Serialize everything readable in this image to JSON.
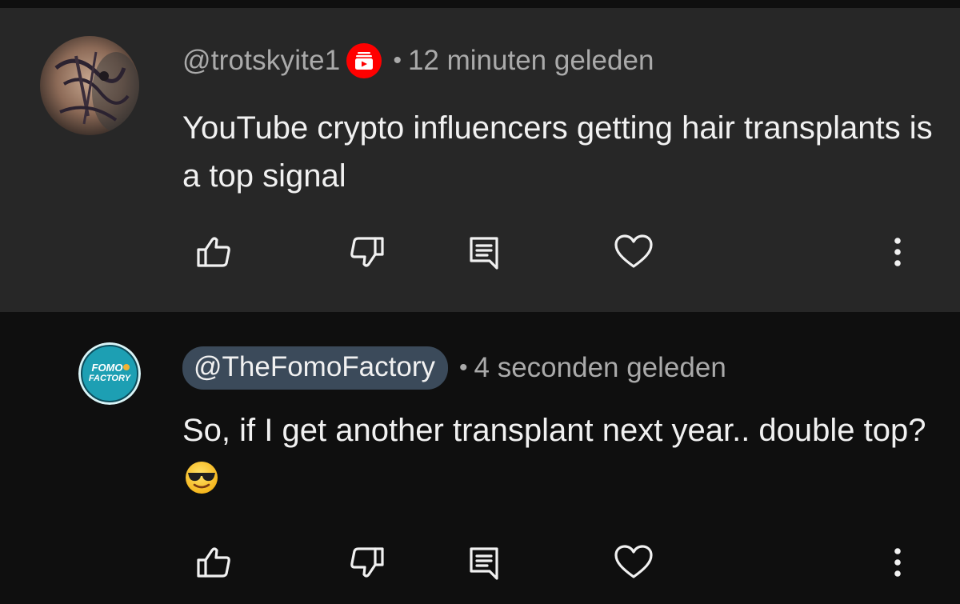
{
  "comments": [
    {
      "author": "@trotskyite1",
      "separator": "•",
      "time": "12 minuten geleden",
      "text": "YouTube crypto influencers getting hair transplants is a top signal",
      "has_badge": true,
      "highlighted": true
    },
    {
      "author": "@TheFomoFactory",
      "separator": "•",
      "time": "4 seconden geleden",
      "text": "So, if I get another transplant next year.. double top?",
      "emoji": "smiling-face-with-sunglasses",
      "avatar_text": [
        "FOMO",
        "FACTORY"
      ],
      "highlighted": false
    }
  ],
  "icons": [
    "like-icon",
    "dislike-icon",
    "reply-icon",
    "heart-icon",
    "more-icon"
  ],
  "colors": {
    "highlight_bg": "#272727",
    "page_bg": "#0f0f0f",
    "text": "#f1f1f1",
    "secondary_text": "#aaaaaa",
    "badge_red": "#ff0000",
    "author_pill": "#3b4a5a",
    "fomo_teal": "#1fb8c9"
  }
}
